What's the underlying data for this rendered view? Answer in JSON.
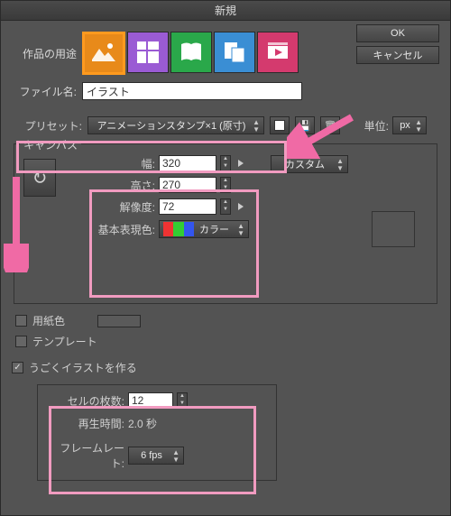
{
  "title": "新規",
  "purpose_label": "作品の用途",
  "filename_label": "ファイル名:",
  "filename_value": "イラスト",
  "buttons": {
    "ok": "OK",
    "cancel": "キャンセル"
  },
  "preset_label": "プリセット:",
  "preset_value": "アニメーションスタンプ×1 (原寸)",
  "unit_label": "単位:",
  "unit_value": "px",
  "canvas": {
    "legend": "キャンバス",
    "width_label": "幅:",
    "width_value": "320",
    "height_label": "高さ:",
    "height_value": "270",
    "resolution_label": "解像度:",
    "resolution_value": "72",
    "colormode_label": "基本表現色:",
    "colormode_value": "カラー",
    "custom_label": "カスタム"
  },
  "papercolor_label": "用紙色",
  "template_label": "テンプレート",
  "anim": {
    "check_label": "うごくイラストを作る",
    "cells_label": "セルの枚数:",
    "cells_value": "12",
    "playtime_label": "再生時間:",
    "playtime_value": "2.0 秒",
    "framerate_label": "フレームレート:",
    "framerate_value": "6 fps"
  },
  "icons": {
    "rotate": "↻",
    "save": "💾",
    "trash": "🗑",
    "check": "✓"
  }
}
